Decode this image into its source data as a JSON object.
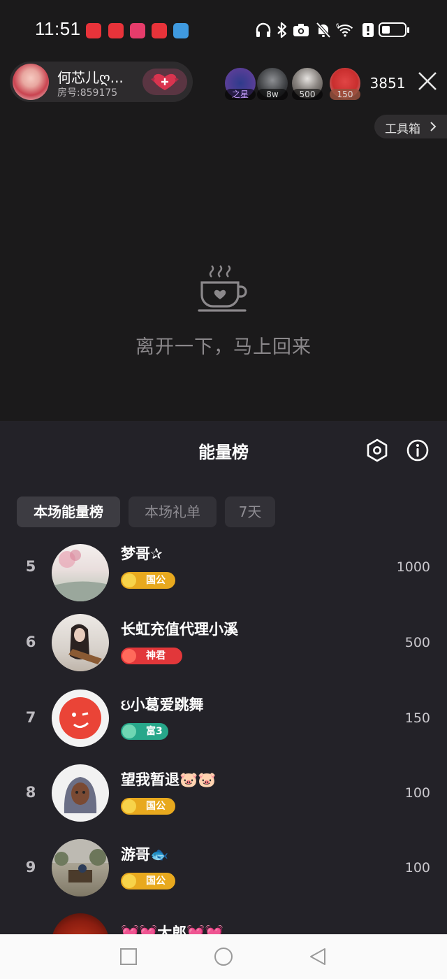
{
  "status_bar": {
    "time": "11:51"
  },
  "room": {
    "host_name": "何芯儿ღ...",
    "room_id": "房号:859175",
    "viewers": [
      {
        "tag": "之星"
      },
      {
        "tag": "8w"
      },
      {
        "tag": "500"
      },
      {
        "tag": "150"
      }
    ],
    "viewer_count": "3851",
    "toolbox_label": "工具箱"
  },
  "away": {
    "message": "离开一下，马上回来"
  },
  "sheet": {
    "title": "能量榜",
    "tabs": [
      {
        "label": "本场能量榜",
        "active": true
      },
      {
        "label": "本场礼单",
        "active": false
      },
      {
        "label": "7天",
        "active": false
      }
    ],
    "rows": [
      {
        "rank": "5",
        "name": "梦哥✰",
        "badge": "国公",
        "badge_type": "gold",
        "score": "1000"
      },
      {
        "rank": "6",
        "name": "长虹充值代理小溪",
        "badge": "神君",
        "badge_type": "red",
        "score": "500"
      },
      {
        "rank": "7",
        "name": "ઇ小葛爱跳舞",
        "badge": "富3",
        "badge_type": "green",
        "score": "150"
      },
      {
        "rank": "8",
        "name": "望我暂退🐷🐷",
        "badge": "国公",
        "badge_type": "gold",
        "score": "100"
      },
      {
        "rank": "9",
        "name": "游哥🐟",
        "badge": "国公",
        "badge_type": "gold",
        "score": "100"
      },
      {
        "rank": "",
        "name": "💓💓大郎💓💓",
        "badge": "",
        "badge_type": "",
        "score": ""
      }
    ]
  },
  "colors": {
    "sheet_bg": "#232228",
    "gold_badge": "#e8a91e",
    "red_badge": "#e2373a",
    "green_badge": "#27a78a"
  }
}
